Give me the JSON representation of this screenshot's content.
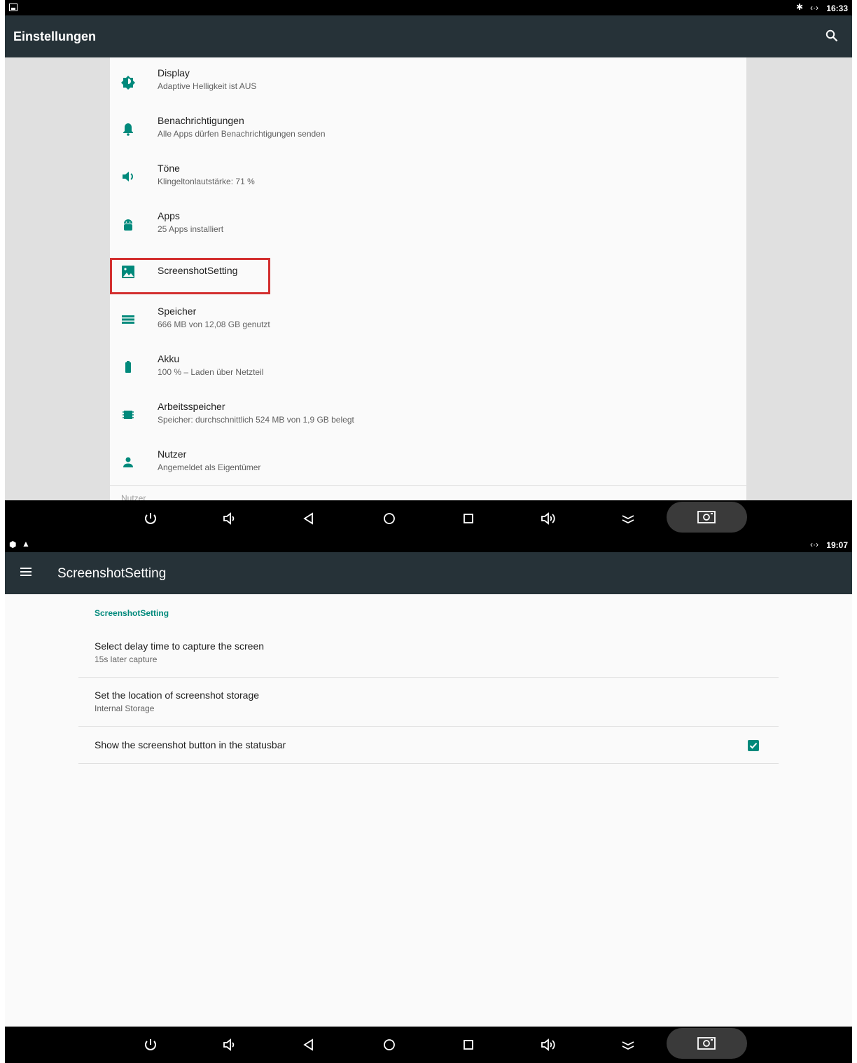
{
  "panelA": {
    "statusbar": {
      "time": "16:33"
    },
    "appbar": {
      "title": "Einstellungen"
    },
    "items": [
      {
        "title": "Display",
        "subtitle": "Adaptive Helligkeit ist AUS",
        "icon": "brightness-icon"
      },
      {
        "title": "Benachrichtigungen",
        "subtitle": "Alle Apps dürfen Benachrichtigungen senden",
        "icon": "bell-icon"
      },
      {
        "title": "Töne",
        "subtitle": "Klingeltonlautstärke: 71 %",
        "icon": "volume-icon"
      },
      {
        "title": "Apps",
        "subtitle": "25 Apps installiert",
        "icon": "android-icon"
      },
      {
        "title": "ScreenshotSetting",
        "subtitle": "",
        "icon": "image-icon"
      },
      {
        "title": "Speicher",
        "subtitle": "666 MB von 12,08 GB genutzt",
        "icon": "storage-icon"
      },
      {
        "title": "Akku",
        "subtitle": "100 % – Laden über Netzteil",
        "icon": "battery-icon"
      },
      {
        "title": "Arbeitsspeicher",
        "subtitle": "Speicher: durchschnittlich 524 MB von 1,9 GB belegt",
        "icon": "memory-icon"
      },
      {
        "title": "Nutzer",
        "subtitle": "Angemeldet als Eigentümer",
        "icon": "person-icon"
      }
    ],
    "cut_label": "Nutzer"
  },
  "panelB": {
    "statusbar": {
      "time": "19:07"
    },
    "appbar": {
      "title": "ScreenshotSetting"
    },
    "section_title": "ScreenshotSetting",
    "prefs": [
      {
        "title": "Select delay time to capture the screen",
        "subtitle": "15s later capture"
      },
      {
        "title": "Set the location of screenshot storage",
        "subtitle": "Internal Storage"
      },
      {
        "title": "Show the screenshot button in the statusbar",
        "checked": true
      }
    ]
  },
  "accent": "#00897b",
  "toolbar": "#263238"
}
